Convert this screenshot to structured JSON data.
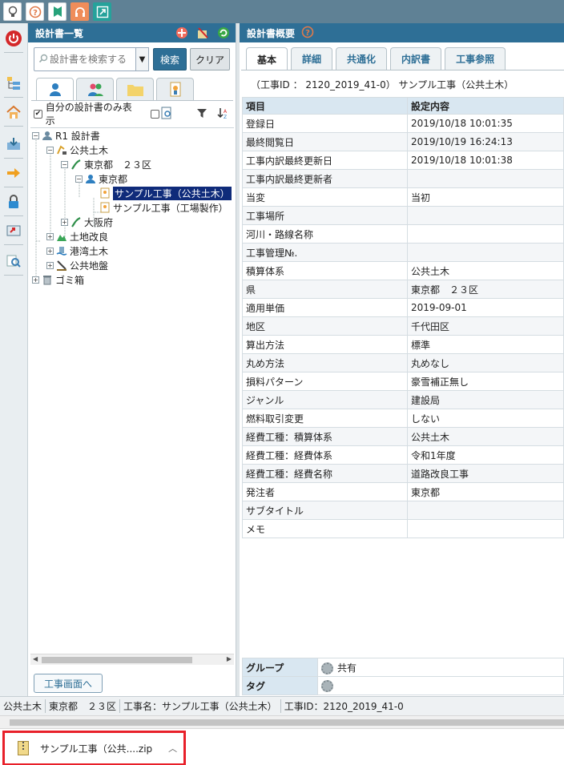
{
  "toolbar": {
    "buttons": [
      {
        "name": "lightbulb-icon",
        "glyph": "♀"
      },
      {
        "name": "help-icon",
        "glyph": "?"
      },
      {
        "name": "bookmark-icon",
        "glyph": "⚑"
      },
      {
        "name": "headset-icon",
        "glyph": "☊"
      },
      {
        "name": "expand-icon",
        "glyph": "↗"
      }
    ]
  },
  "left_panel": {
    "title": "設計書一覧",
    "search": {
      "placeholder": "設計書を検索する",
      "search_label": "検索",
      "clear_label": "クリア"
    },
    "filter_label": "自分の設計書のみ表示",
    "tree": {
      "root": "R1 設計書",
      "n1": "公共土木",
      "n2": "東京都　２３区",
      "n3": "東京都",
      "n4": "サンプル工事（公共土木）",
      "n5": "サンプル工事（工場製作）",
      "n6": "大阪府",
      "n7": "土地改良",
      "n8": "港湾土木",
      "n9": "公共地盤",
      "n10": "ゴミ箱"
    },
    "koji_button": "工事画面へ"
  },
  "right_panel": {
    "title": "設計書概要",
    "tabs": [
      "基本",
      "詳細",
      "共通化",
      "内訳書",
      "工事参照"
    ],
    "koji_id_line": "（工事ID ： 2120_2019_41-0）  サンプル工事（公共土木）",
    "headers": [
      "項目",
      "設定内容"
    ],
    "rows": [
      [
        "登録日",
        "2019/10/18 10:01:35"
      ],
      [
        "最終閲覧日",
        "2019/10/19 16:24:13"
      ],
      [
        "工事内訳最終更新日",
        "2019/10/18 10:01:38"
      ],
      [
        "工事内訳最終更新者",
        ""
      ],
      [
        "当変",
        "当初"
      ],
      [
        "工事場所",
        ""
      ],
      [
        "河川・路線名称",
        ""
      ],
      [
        "工事管理№.",
        ""
      ],
      [
        "積算体系",
        "公共土木"
      ],
      [
        "県",
        "東京都　２３区"
      ],
      [
        "適用単価",
        "2019-09-01"
      ],
      [
        "地区",
        "千代田区"
      ],
      [
        "算出方法",
        "標準"
      ],
      [
        "丸め方法",
        "丸めなし"
      ],
      [
        "損料パターン",
        "豪雪補正無し"
      ],
      [
        "ジャンル",
        "建設局"
      ],
      [
        "燃料取引変更",
        "しない"
      ],
      [
        "経費工種：積算体系",
        "公共土木"
      ],
      [
        "経費工種：経費体系",
        "令和1年度"
      ],
      [
        "経費工種：経費名称",
        "道路改良工事"
      ],
      [
        "発注者",
        "東京都"
      ],
      [
        "サブタイトル",
        ""
      ],
      [
        "メモ",
        ""
      ]
    ],
    "group_label": "グループ",
    "group_value": "共有",
    "tag_label": "タグ"
  },
  "status": {
    "items": [
      "公共土木",
      "東京都　２３区",
      "工事名：サンプル工事（公共土木）",
      "工事ID：2120_2019_41-0"
    ]
  },
  "download": {
    "filename": "サンプル工事（公共....zip"
  }
}
